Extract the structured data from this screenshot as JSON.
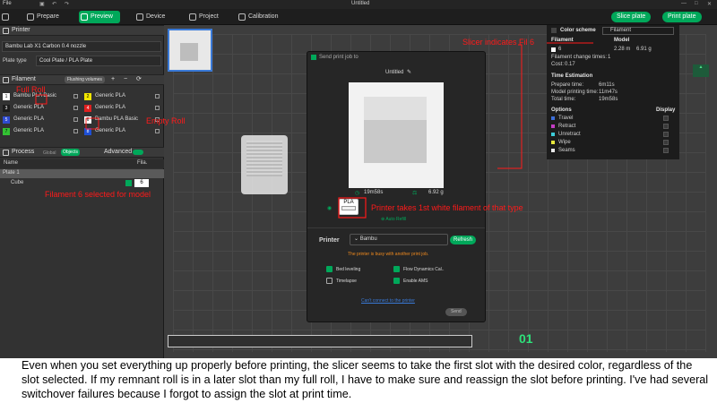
{
  "titlebar": {
    "file": "File",
    "title": "Untitled"
  },
  "tabs": {
    "prepare": "Prepare",
    "preview": "Preview",
    "device": "Device",
    "project": "Project",
    "calibration": "Calibration"
  },
  "toolbar": {
    "slice_plate": "Slice plate",
    "print_plate": "Print plate"
  },
  "printer": {
    "section": "Printer",
    "model": "Bambu Lab X1 Carbon 0.4 nozzle",
    "plate_type_label": "Plate type",
    "plate_type_value": "Cool Plate / PLA Plate"
  },
  "filament": {
    "section": "Filament",
    "flushing": "Flushing volumes",
    "slots": [
      {
        "num": "1",
        "name": "Bambu PLA Basic",
        "color": "#ffffff"
      },
      {
        "num": "2",
        "name": "Generic PLA",
        "color": "#f2e600"
      },
      {
        "num": "3",
        "name": "Generic PLA",
        "color": "#1b1b1b"
      },
      {
        "num": "4",
        "name": "Generic PLA",
        "color": "#e02020"
      },
      {
        "num": "5",
        "name": "Generic PLA",
        "color": "#2f4bd0"
      },
      {
        "num": "6",
        "name": "Bambu PLA Basic",
        "color": "#ffffff"
      },
      {
        "num": "7",
        "name": "Generic PLA",
        "color": "#33c233"
      },
      {
        "num": "8",
        "name": "Generic PLA",
        "color": "#1e4fd6"
      }
    ]
  },
  "process": {
    "section": "Process",
    "global": "Global",
    "objects": "Objects",
    "advanced": "Advanced",
    "col_name": "Name",
    "col_fila": "Fila.",
    "plate": "Plate 1",
    "object": "Cube",
    "object_slot": "6"
  },
  "color_scheme": {
    "label": "Color scheme",
    "value": "Filament",
    "col_filament": "Filament",
    "col_model": "Model",
    "slot": "6",
    "length": "2.28 m",
    "weight": "6.91 g",
    "filament_change_label": "Filament change times:",
    "filament_change_value": "1",
    "cost_label": "Cost:",
    "cost_value": "0.17"
  },
  "time_estimation": {
    "header": "Time Estimation",
    "prepare_label": "Prepare time:",
    "prepare_value": "6m11s",
    "model_label": "Model printing time:",
    "model_value": "11m47s",
    "total_label": "Total time:",
    "total_value": "19m58s"
  },
  "options": {
    "header": "Options",
    "display": "Display",
    "items": [
      "Travel",
      "Retract",
      "Unretract",
      "Wipe",
      "Seams"
    ],
    "colors": [
      "#3c6ed8",
      "#c43cc4",
      "#3ccbd8",
      "#e8e83c",
      "#e8e8e8"
    ]
  },
  "dialog": {
    "title": "Send print job to",
    "name": "Untitled",
    "time": "19m58s",
    "weight": "6.92 g",
    "material": "PLA",
    "auto_refill": "Auto Refill",
    "printer_label": "Printer",
    "printer_value": "Bambu",
    "refresh": "Refresh",
    "warning": "The printer is busy with another print job.",
    "bed_leveling": "Bed leveling",
    "flow_cal": "Flow Dynamics Cal..",
    "timelapse": "Timelapse",
    "enable_ams": "Enable AMS",
    "cant_connect": "Can't connect to the printer",
    "send": "Send"
  },
  "viewport": {
    "plate_number": "01"
  },
  "annotations": {
    "full_roll": "Full Roll",
    "empty_roll": "Empty Roll",
    "fil6_selected": "Filament 6 selected for model",
    "slicer_indicates": "Slicer indicates Fil 6",
    "printer_takes": "Printer takes 1st white filament of that type"
  },
  "caption": "Even when you set everything up properly before printing, the slicer seems to take the first slot with the desired color, regardless of the slot selected. If my remnant roll is in a later slot than my full roll, I have to make sure and reassign the slot before printing. I've had several switchover failures because I forgot to assign the slot at print time."
}
